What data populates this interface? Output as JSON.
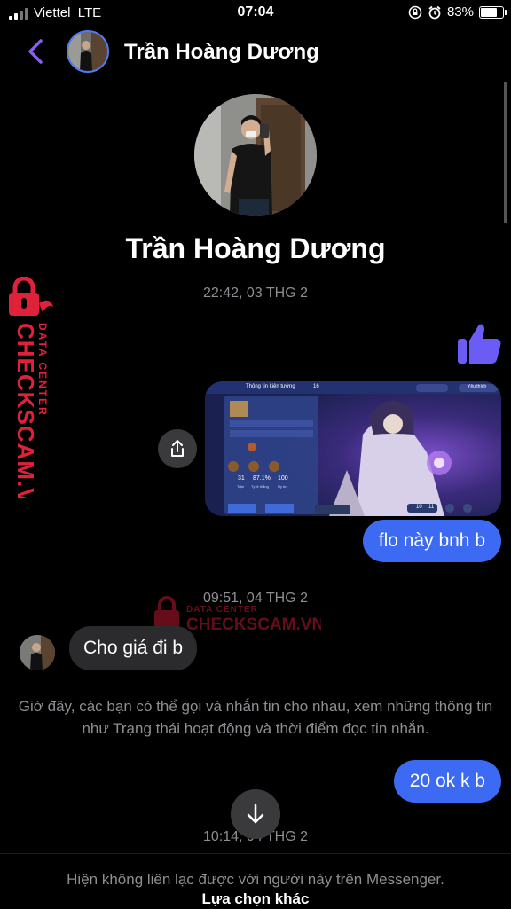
{
  "status_bar": {
    "carrier": "Viettel",
    "network": "LTE",
    "time": "07:04",
    "battery": "83%",
    "battery_level": 0.83
  },
  "header": {
    "contact_name": "Trần Hoàng Dương"
  },
  "profile": {
    "name": "Trần Hoàng Dương"
  },
  "watermark": {
    "title": "DATA CENTER",
    "brand": "CHECKSCAM.VN",
    "color": "#e0213a"
  },
  "conversation": {
    "timestamp_1": "22:42, 03 THG 2",
    "screenshot_ui": {
      "header": "Thông tin kiện tướng",
      "count": "16",
      "badge": "Yêu thích",
      "stat_1_value": "31",
      "stat_1_label": "Trận",
      "stat_2_value": "87.1%",
      "stat_2_label": "Tỷ lệ thắng",
      "stat_3_value": "100",
      "stat_3_label": "Uy tín",
      "right_value": "10",
      "right_value_2": "11"
    },
    "outgoing_1": "flo này bnh b",
    "timestamp_2": "09:51, 04 THG 2",
    "incoming_1": "Cho giá đi b",
    "system_notice": "Giờ đây, các bạn có thể gọi và nhắn tin cho nhau, xem những thông tin như Trạng thái hoạt động và thời điểm đọc tin nhắn.",
    "outgoing_2": "20 ok k b",
    "timestamp_3": "10:14, 04 THG 2"
  },
  "footer": {
    "notice": "Hiện không liên lạc được với người này trên Messenger.",
    "action": "Lựa chọn khác"
  },
  "colors": {
    "accent": "#3c6af2",
    "back_arrow": "#8b5cf6"
  }
}
